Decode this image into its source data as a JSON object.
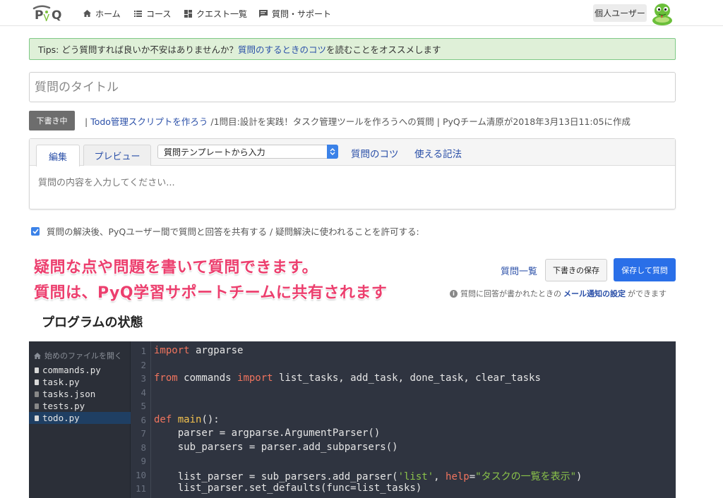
{
  "nav": {
    "logo": "PyQ",
    "home": "ホーム",
    "course": "コース",
    "quests": "クエスト一覧",
    "support": "質問・サポート",
    "user": "個人ユーザー"
  },
  "tips": {
    "prefix": "Tips: どう質問すれば良いか不安はありませんか？",
    "link": "質問のするときのコツ",
    "suffix": " を読むことをオススメします"
  },
  "title_input": {
    "placeholder": "質問のタイトル"
  },
  "draft": {
    "badge": "下書き中",
    "sep1": "| ",
    "link": "Todo管理スクリプトを作ろう",
    "info": " /1問目:設計を実践！タスク管理ツールを作ろうへの質問  | PyQチーム清原が2018年3月13日11:05に作成"
  },
  "editor": {
    "tab_edit": "編集",
    "tab_preview": "プレビュー",
    "template_select": "質問テンプレートから入力",
    "tips_link": "質問のコツ",
    "syntax_link": "使える記法",
    "body_placeholder": "質問の内容を入力してください..."
  },
  "share_checkbox": {
    "checked": true,
    "label": "質問の解決後、PyQユーザー間で質問と回答を共有する / 疑問解決に使われることを許可する:"
  },
  "annotation": {
    "line1": "疑問な点や問題を書いて質問できます。",
    "line2": "質問は、PyQ学習サポートチームに共有されます"
  },
  "actions": {
    "question_list": "質問一覧",
    "save_draft": "下書きの保存",
    "save_and_ask": "保存して質問"
  },
  "notify": {
    "prefix": "質問に回答が書かれたときの",
    "link": "メール通知の設定",
    "suffix": "ができます"
  },
  "program": {
    "heading": "プログラムの状態",
    "tree_header": "始めのファイルを開く",
    "files": [
      "commands.py",
      "task.py",
      "tasks.json",
      "tests.py",
      "todo.py"
    ],
    "active_file": "todo.py",
    "line_numbers": [
      "1",
      "2",
      "3",
      "4",
      "5",
      "6",
      "7",
      "8",
      "9",
      "10",
      "11"
    ],
    "code": {
      "l1_kw": "import",
      "l1_rest": " argparse",
      "l3_kw1": "from",
      "l3_mid": " commands ",
      "l3_kw2": "import",
      "l3_rest": " list_tasks, add_task, done_task, clear_tasks",
      "l6_kw": "def",
      "l6_fn": " main",
      "l6_rest": "():",
      "l7": "    parser = argparse.ArgumentParser()",
      "l8": "    sub_parsers = parser.add_subparsers()",
      "l10_a": "    list_parser = sub_parsers.add_parser(",
      "l10_str1": "'list'",
      "l10_b": ", ",
      "l10_arg": "help",
      "l10_c": "=",
      "l10_str2": "\"タスクの一覧を表示\"",
      "l10_d": ")",
      "l11": "    list_parser.set_defaults(func=list_tasks)"
    }
  },
  "colors": {
    "accent": "#2a6fe8",
    "tips_bg": "#dff0d8",
    "annotation": "#ec3f6e",
    "code_bg": "#2f3440"
  }
}
